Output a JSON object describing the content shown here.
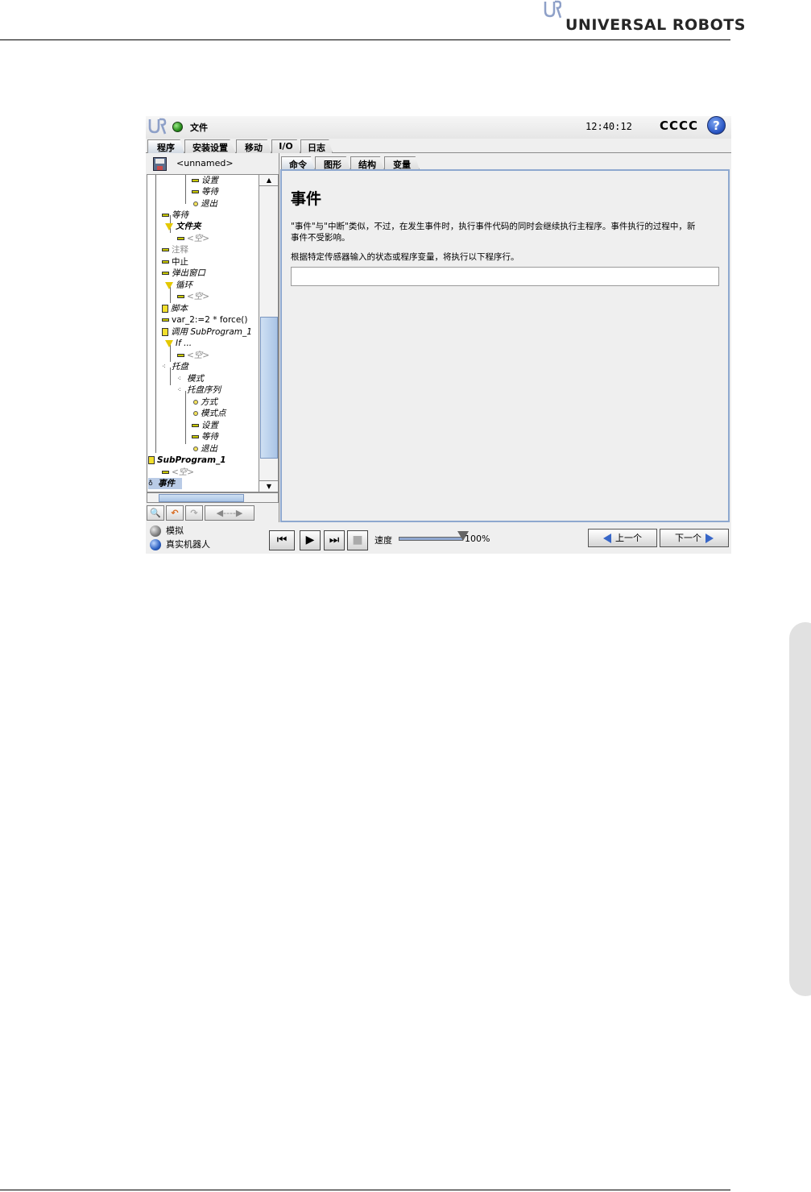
{
  "page": {
    "brand_name": "UNIVERSAL ROBOTS",
    "brand_mark": "UR"
  },
  "app": {
    "file_menu": "文件",
    "clock": "12:40:12",
    "robot_name": "CCCC",
    "help_glyph": "?",
    "main_tabs": [
      "程序",
      "安装设置",
      "移动",
      "I/O",
      "日志"
    ],
    "program_name": "<unnamed>",
    "sub_tabs": [
      "命令",
      "图形",
      "结构",
      "变量"
    ]
  },
  "tree": {
    "items": [
      {
        "label": "设置",
        "icon": "bar-icon"
      },
      {
        "label": "等待",
        "icon": "bar-icon"
      },
      {
        "label": "退出",
        "icon": "dot-icon"
      },
      {
        "label": "等待",
        "icon": "bar-icon"
      },
      {
        "label": "文件夹",
        "icon": "folder-triangle-icon"
      },
      {
        "label": "<空>",
        "icon": "bar-icon"
      },
      {
        "label": "注释",
        "icon": "bar-icon"
      },
      {
        "label": "中止",
        "icon": "bar-icon"
      },
      {
        "label": "弹出窗口",
        "icon": "bar-icon"
      },
      {
        "label": "循环",
        "icon": "loop-triangle-icon"
      },
      {
        "label": "<空>",
        "icon": "bar-icon"
      },
      {
        "label": "脚本",
        "icon": "script-icon"
      },
      {
        "label": "var_2:=2 * force()",
        "icon": "bar-icon"
      },
      {
        "label": "调用 SubProgram_1",
        "icon": "call-icon"
      },
      {
        "label": "If ...",
        "icon": "if-triangle-icon"
      },
      {
        "label": "<空>",
        "icon": "bar-icon"
      },
      {
        "label": "托盘",
        "icon": "pallet-icon"
      },
      {
        "label": "模式",
        "icon": "pallet-icon"
      },
      {
        "label": "托盘序列",
        "icon": "pallet-icon"
      },
      {
        "label": "方式",
        "icon": "dot-icon"
      },
      {
        "label": "模式点",
        "icon": "dot-icon"
      },
      {
        "label": "设置",
        "icon": "bar-icon"
      },
      {
        "label": "等待",
        "icon": "bar-icon"
      },
      {
        "label": "退出",
        "icon": "dot-icon"
      },
      {
        "label": "SubProgram_1",
        "icon": "subprogram-icon"
      },
      {
        "label": "<空>",
        "icon": "bar-icon"
      },
      {
        "label": "事件",
        "icon": "event-icon"
      }
    ]
  },
  "content": {
    "heading": "事件",
    "description": "\"事件\"与\"中断\"类似，不过，在发生事件时，执行事件代码的同时会继续执行主程序。事件执行的过程中，新事件不受影响。",
    "instruction": "根据特定传感器输入的状态或程序变量，将执行以下程序行。",
    "expression_value": ""
  },
  "bottom": {
    "mode_simulation": "模拟",
    "mode_real_robot": "真实机器人",
    "speed_label": "速度",
    "speed_value": "100%",
    "speed_fraction": 1.0,
    "prev_label": "上一个",
    "next_label": "下一个"
  },
  "colors": {
    "status_green": "#2a8f1e",
    "accent_blue": "#3766c8",
    "panel_border": "#8ea8cf"
  }
}
